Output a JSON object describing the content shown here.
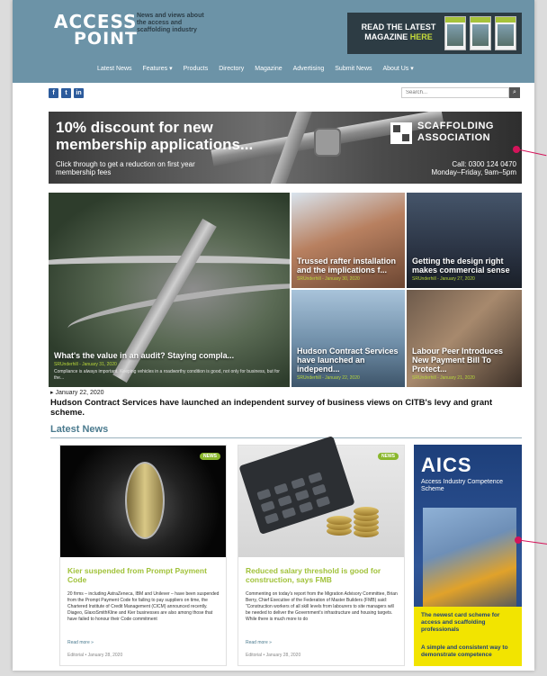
{
  "header": {
    "logo_line1": "ACCESS",
    "logo_line2": "POINT",
    "tagline": "News and views about the access and scaffolding industry",
    "promo_text_a": "READ THE LATEST",
    "promo_text_b": "MAGAZINE",
    "promo_text_c": "HERE"
  },
  "nav": {
    "items": [
      "Latest News",
      "Features",
      "Products",
      "Directory",
      "Magazine",
      "Advertising",
      "Submit News",
      "About Us"
    ]
  },
  "search": {
    "placeholder": "Search..."
  },
  "banner": {
    "headline": "10% discount for new membership applications...",
    "sub": "Click through to get a reduction on first year membership fees",
    "org_line1": "SCAFFOLDING",
    "org_line2": "ASSOCIATION",
    "call": "Call: 0300 124 0470",
    "hours": "Monday–Friday, 9am–5pm"
  },
  "grid": {
    "big": {
      "title": "What's the value in an audit? Staying compla...",
      "meta": "SRUnderhill - January 31, 2020",
      "excerpt": "Compliance is always important. Keeping vehicles in a roadworthy condition is good, not only for business, but for the..."
    },
    "t1": {
      "title": "Trussed rafter installation and the implications f...",
      "meta": "SRUnderhill - January 30, 2020"
    },
    "t2": {
      "title": "Getting the design right makes commercial sense",
      "meta": "SRUnderhill - January 27, 2020"
    },
    "t3": {
      "title": "Hudson Contract Services have launched an independ...",
      "meta": "SRUnderhill - January 22, 2020"
    },
    "t4": {
      "title": "Labour Peer Introduces New Payment Bill To Protect...",
      "meta": "SRUnderhill - January 21, 2020"
    }
  },
  "feature": {
    "date": "January 22, 2020",
    "headline": "Hudson Contract Services have launched an independent survey of business views on CITB's levy and grant scheme."
  },
  "latest": {
    "title": "Latest News",
    "cards": [
      {
        "badge": "NEWS",
        "title": "Kier suspended from Prompt Payment Code",
        "excerpt": "20 firms – including AstraZeneca, IBM and Unilever – have been suspended from the Prompt Payment Code for failing to pay suppliers on time, the Chartered Institute of Credit Management (CICM) announced recently. Diageo, GlaxoSmithKline and Kier businesses are also among those that have failed to honour their Code commitment",
        "more": "Read more »",
        "meta": "Editorial • January 28, 2020"
      },
      {
        "badge": "NEWS",
        "title": "Reduced salary threshold is good for construction, says FMB",
        "excerpt": "Commenting on today's report from the Migration Advisory Committee, Brian Berry, Chief Executive of the Federation of Master Builders (FMB) said: “Construction workers of all skill levels from labourers to site managers will be needed to deliver the Government's infrastructure and housing targets. While there is much more to do",
        "more": "Read more »",
        "meta": "Editorial • January 28, 2020"
      }
    ]
  },
  "aics": {
    "name": "AICS",
    "full": "Access Industry Competence Scheme",
    "p1": "The newest card scheme for access and scaffolding professionals",
    "p2": "A simple and consistent way to demonstrate competence"
  },
  "colors": {
    "header_bg": "#6c93a7",
    "accent_green": "#a1c23a",
    "pointer": "#d4145a"
  }
}
